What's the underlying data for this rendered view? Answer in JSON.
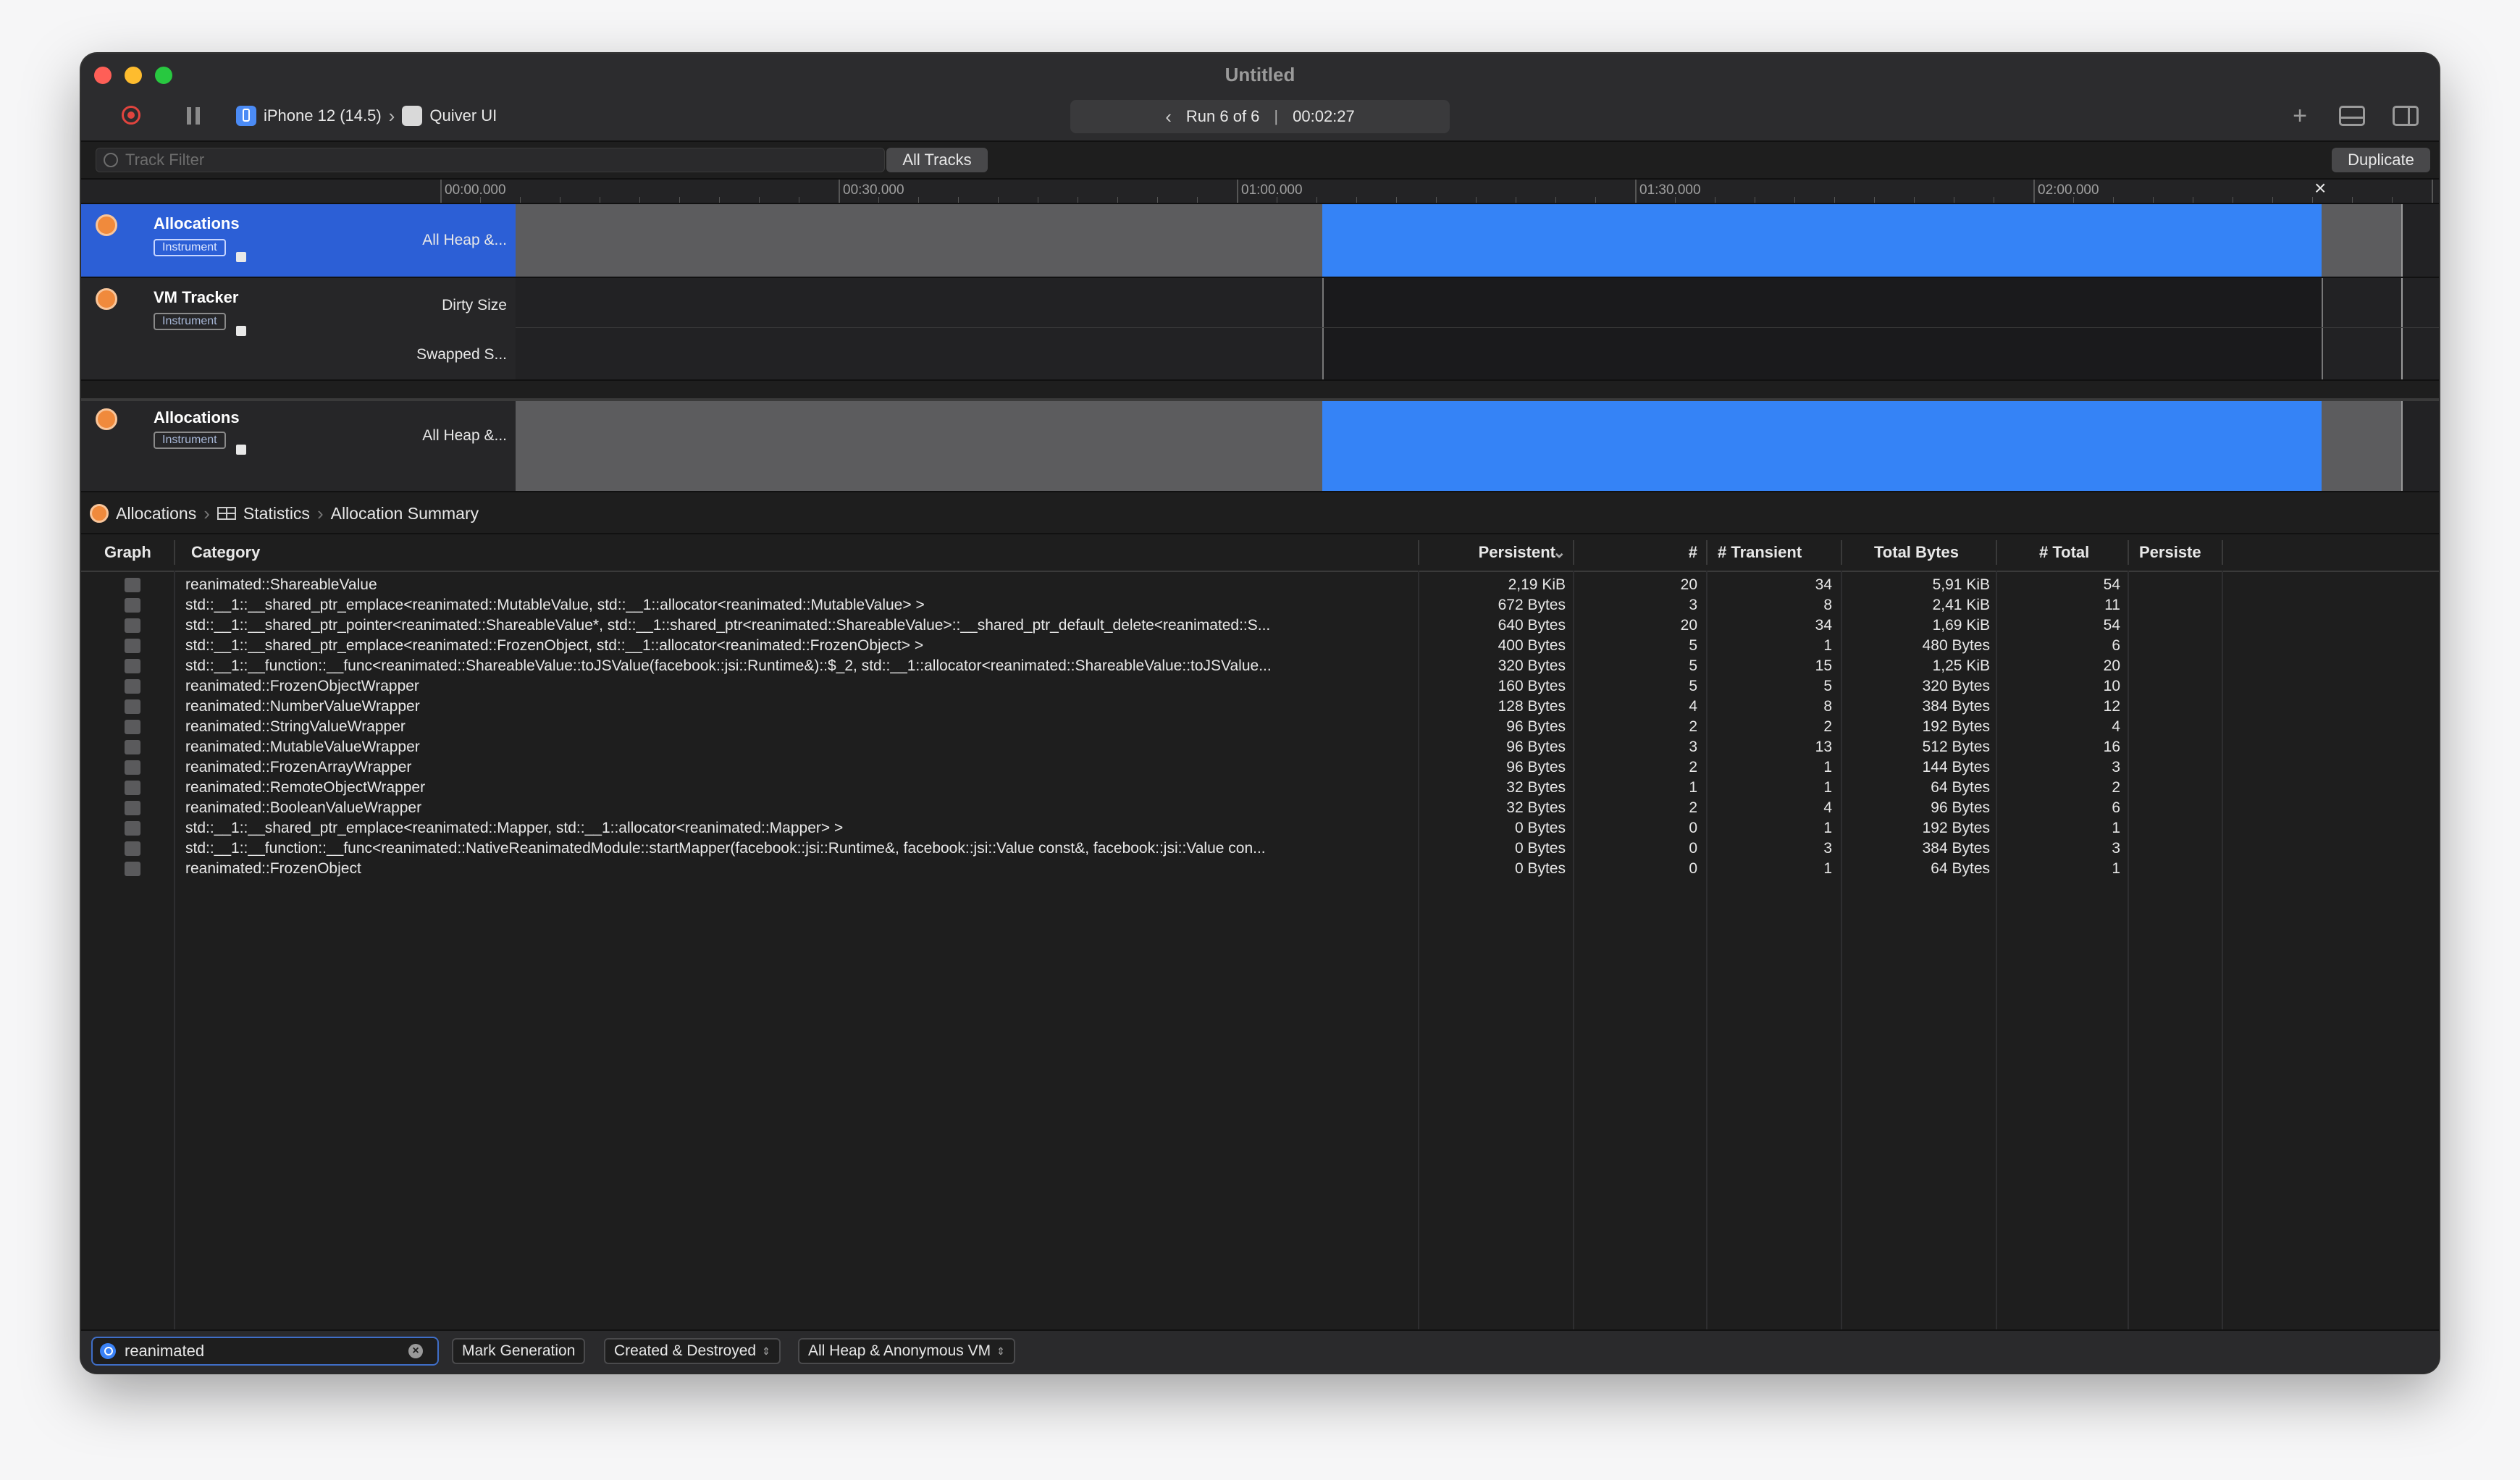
{
  "window": {
    "title": "Untitled"
  },
  "toolbar": {
    "device": "iPhone 12 (14.5)",
    "app": "Quiver UI",
    "run_label": "Run 6 of 6",
    "run_time": "00:02:27"
  },
  "filter": {
    "placeholder": "Track Filter",
    "all_tracks": "All Tracks",
    "duplicate": "Duplicate"
  },
  "ruler": {
    "ticks": [
      "00:00.000",
      "00:30.000",
      "01:00.000",
      "01:30.000",
      "02:00.000"
    ]
  },
  "tracks": [
    {
      "name": "Allocations",
      "tag": "Instrument",
      "labels": [
        "All Heap &..."
      ]
    },
    {
      "name": "VM Tracker",
      "tag": "Instrument",
      "labels": [
        "Dirty Size",
        "Swapped S..."
      ]
    },
    {
      "name": "Allocations",
      "tag": "Instrument",
      "labels": [
        "All Heap &..."
      ]
    }
  ],
  "breadcrumb": {
    "instrument": "Allocations",
    "view": "Statistics",
    "detail": "Allocation Summary"
  },
  "table": {
    "headers": {
      "graph": "Graph",
      "category": "Category",
      "persistent": "Persistent",
      "count": "#",
      "transient": "# Transient",
      "total_bytes": "Total Bytes",
      "total": "# Total",
      "persiste": "Persiste"
    },
    "rows": [
      [
        "reanimated::ShareableValue",
        "2,19 KiB",
        "20",
        "34",
        "5,91 KiB",
        "54"
      ],
      [
        "std::__1::__shared_ptr_emplace<reanimated::MutableValue, std::__1::allocator<reanimated::MutableValue> >",
        "672 Bytes",
        "3",
        "8",
        "2,41 KiB",
        "11"
      ],
      [
        "std::__1::__shared_ptr_pointer<reanimated::ShareableValue*, std::__1::shared_ptr<reanimated::ShareableValue>::__shared_ptr_default_delete<reanimated::S...",
        "640 Bytes",
        "20",
        "34",
        "1,69 KiB",
        "54"
      ],
      [
        "std::__1::__shared_ptr_emplace<reanimated::FrozenObject, std::__1::allocator<reanimated::FrozenObject> >",
        "400 Bytes",
        "5",
        "1",
        "480 Bytes",
        "6"
      ],
      [
        "std::__1::__function::__func<reanimated::ShareableValue::toJSValue(facebook::jsi::Runtime&)::$_2, std::__1::allocator<reanimated::ShareableValue::toJSValue...",
        "320 Bytes",
        "5",
        "15",
        "1,25 KiB",
        "20"
      ],
      [
        "reanimated::FrozenObjectWrapper",
        "160 Bytes",
        "5",
        "5",
        "320 Bytes",
        "10"
      ],
      [
        "reanimated::NumberValueWrapper",
        "128 Bytes",
        "4",
        "8",
        "384 Bytes",
        "12"
      ],
      [
        "reanimated::StringValueWrapper",
        "96 Bytes",
        "2",
        "2",
        "192 Bytes",
        "4"
      ],
      [
        "reanimated::MutableValueWrapper",
        "96 Bytes",
        "3",
        "13",
        "512 Bytes",
        "16"
      ],
      [
        "reanimated::FrozenArrayWrapper",
        "96 Bytes",
        "2",
        "1",
        "144 Bytes",
        "3"
      ],
      [
        "reanimated::RemoteObjectWrapper",
        "32 Bytes",
        "1",
        "1",
        "64 Bytes",
        "2"
      ],
      [
        "reanimated::BooleanValueWrapper",
        "32 Bytes",
        "2",
        "4",
        "96 Bytes",
        "6"
      ],
      [
        "std::__1::__shared_ptr_emplace<reanimated::Mapper, std::__1::allocator<reanimated::Mapper> >",
        "0 Bytes",
        "0",
        "1",
        "192 Bytes",
        "1"
      ],
      [
        "std::__1::__function::__func<reanimated::NativeReanimatedModule::startMapper(facebook::jsi::Runtime&, facebook::jsi::Value const&, facebook::jsi::Value con...",
        "0 Bytes",
        "0",
        "3",
        "384 Bytes",
        "3"
      ],
      [
        "reanimated::FrozenObject",
        "0 Bytes",
        "0",
        "1",
        "64 Bytes",
        "1"
      ]
    ]
  },
  "bottom": {
    "search_value": "reanimated",
    "mark_generation": "Mark Generation",
    "lifespan": "Created & Destroyed",
    "allocation_type": "All Heap & Anonymous VM"
  },
  "colors": {
    "accent": "#3583f6",
    "selected_track": "#2c5fd6",
    "record": "#e0443e",
    "instrument": "#f08a3c"
  }
}
